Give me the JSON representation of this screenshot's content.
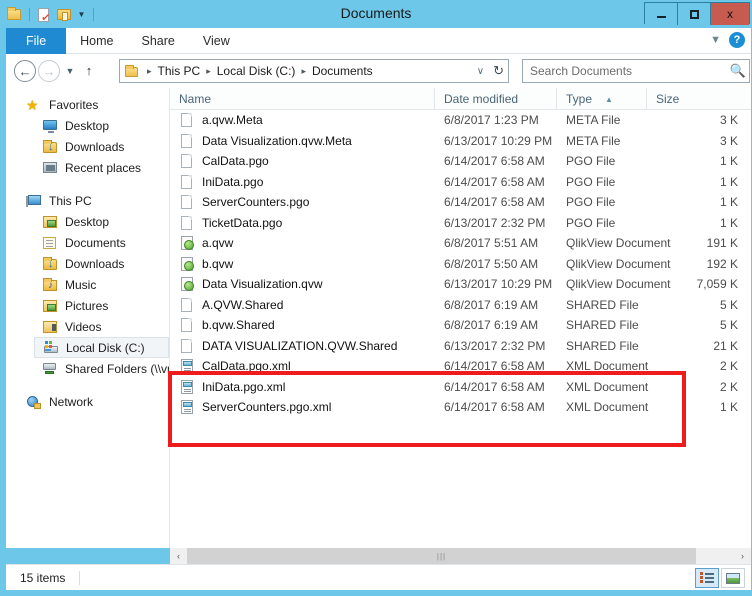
{
  "window": {
    "title": "Documents",
    "minimize_label": "Minimize",
    "maximize_label": "Maximize",
    "close_label": "x"
  },
  "quick_access": {
    "items": [
      "folder-icon",
      "properties-icon",
      "new-folder-icon",
      "customize-dropdown-icon"
    ]
  },
  "ribbon": {
    "tabs": [
      {
        "label": "File",
        "active": true
      },
      {
        "label": "Home",
        "active": false
      },
      {
        "label": "Share",
        "active": false
      },
      {
        "label": "View",
        "active": false
      }
    ],
    "collapse_icon": "chevron-down-icon",
    "help_icon": "help-icon",
    "help_label": "?"
  },
  "navigation": {
    "back_label": "←",
    "forward_label": "→",
    "recent_label": "▾",
    "up_label": "↑",
    "breadcrumb": [
      "This PC",
      "Local Disk (C:)",
      "Documents"
    ],
    "breadcrumb_separator": "▸",
    "history_chevron": "∨",
    "refresh_label": "↻"
  },
  "search": {
    "placeholder": "Search Documents",
    "value": "",
    "icon": "search-icon"
  },
  "sidebar": {
    "groups": [
      {
        "header": {
          "label": "Favorites",
          "icon": "star-icon"
        },
        "items": [
          {
            "label": "Desktop",
            "icon": "monitor-icon"
          },
          {
            "label": "Downloads",
            "icon": "downloads-folder-icon"
          },
          {
            "label": "Recent places",
            "icon": "recent-places-icon"
          }
        ]
      },
      {
        "header": {
          "label": "This PC",
          "icon": "computer-icon"
        },
        "items": [
          {
            "label": "Desktop",
            "icon": "desktop-folder-icon"
          },
          {
            "label": "Documents",
            "icon": "documents-folder-icon"
          },
          {
            "label": "Downloads",
            "icon": "downloads-folder-icon"
          },
          {
            "label": "Music",
            "icon": "music-folder-icon"
          },
          {
            "label": "Pictures",
            "icon": "pictures-folder-icon"
          },
          {
            "label": "Videos",
            "icon": "videos-folder-icon"
          },
          {
            "label": "Local Disk (C:)",
            "icon": "local-disk-icon",
            "selected": true
          },
          {
            "label": "Shared Folders (\\\\vn",
            "icon": "network-drive-icon"
          }
        ]
      },
      {
        "header": {
          "label": "Network",
          "icon": "network-icon"
        },
        "items": []
      }
    ]
  },
  "file_list": {
    "columns": [
      {
        "label": "Name",
        "sorted": false
      },
      {
        "label": "Date modified",
        "sorted": false
      },
      {
        "label": "Type",
        "sorted": true,
        "sort_direction": "asc",
        "sort_glyph": "▲"
      },
      {
        "label": "Size",
        "sorted": false
      }
    ],
    "rows": [
      {
        "name": "a.qvw.Meta",
        "date": "6/8/2017 1:23 PM",
        "type": "META File",
        "size": "3 K",
        "icon": "blank-file-icon"
      },
      {
        "name": "Data Visualization.qvw.Meta",
        "date": "6/13/2017 10:29 PM",
        "type": "META File",
        "size": "3 K",
        "icon": "blank-file-icon"
      },
      {
        "name": "CalData.pgo",
        "date": "6/14/2017 6:58 AM",
        "type": "PGO File",
        "size": "1 K",
        "icon": "blank-file-icon"
      },
      {
        "name": "IniData.pgo",
        "date": "6/14/2017 6:58 AM",
        "type": "PGO File",
        "size": "1 K",
        "icon": "blank-file-icon"
      },
      {
        "name": "ServerCounters.pgo",
        "date": "6/14/2017 6:58 AM",
        "type": "PGO File",
        "size": "1 K",
        "icon": "blank-file-icon"
      },
      {
        "name": "TicketData.pgo",
        "date": "6/13/2017 2:32 PM",
        "type": "PGO File",
        "size": "1 K",
        "icon": "blank-file-icon"
      },
      {
        "name": "a.qvw",
        "date": "6/8/2017 5:51 AM",
        "type": "QlikView Document",
        "size": "191 K",
        "icon": "qlikview-document-icon"
      },
      {
        "name": "b.qvw",
        "date": "6/8/2017 5:50 AM",
        "type": "QlikView Document",
        "size": "192 K",
        "icon": "qlikview-document-icon"
      },
      {
        "name": "Data Visualization.qvw",
        "date": "6/13/2017 10:29 PM",
        "type": "QlikView Document",
        "size": "7,059 K",
        "icon": "qlikview-document-icon"
      },
      {
        "name": "A.QVW.Shared",
        "date": "6/8/2017 6:19 AM",
        "type": "SHARED File",
        "size": "5 K",
        "icon": "blank-file-icon"
      },
      {
        "name": "b.qvw.Shared",
        "date": "6/8/2017 6:19 AM",
        "type": "SHARED File",
        "size": "5 K",
        "icon": "blank-file-icon"
      },
      {
        "name": "DATA VISUALIZATION.QVW.Shared",
        "date": "6/13/2017 2:32 PM",
        "type": "SHARED File",
        "size": "21 K",
        "icon": "blank-file-icon"
      },
      {
        "name": "CalData.pgo.xml",
        "date": "6/14/2017 6:58 AM",
        "type": "XML Document",
        "size": "2 K",
        "icon": "xml-document-icon",
        "highlighted": true
      },
      {
        "name": "IniData.pgo.xml",
        "date": "6/14/2017 6:58 AM",
        "type": "XML Document",
        "size": "2 K",
        "icon": "xml-document-icon",
        "highlighted": true
      },
      {
        "name": "ServerCounters.pgo.xml",
        "date": "6/14/2017 6:58 AM",
        "type": "XML Document",
        "size": "1 K",
        "icon": "xml-document-icon",
        "highlighted": true
      }
    ]
  },
  "annotation": {
    "color": "#ee1c1c",
    "shape": "rectangle",
    "targets": [
      "CalData.pgo.xml",
      "IniData.pgo.xml",
      "ServerCounters.pgo.xml"
    ]
  },
  "scrollbar": {
    "left_arrow": "‹",
    "right_arrow": "›",
    "grip": "|||"
  },
  "status_bar": {
    "item_count": "15 items",
    "views": [
      {
        "label": "Details view",
        "icon": "details-view-icon",
        "active": true
      },
      {
        "label": "Large icons view",
        "icon": "thumbnail-view-icon",
        "active": false
      }
    ]
  },
  "colors": {
    "window_frame": "#6dc7e8",
    "file_tab": "#1f8ad2",
    "close_button": "#c75b4f",
    "annotation_red": "#ee1c1c",
    "selected_nav": "#f2f5f7"
  }
}
